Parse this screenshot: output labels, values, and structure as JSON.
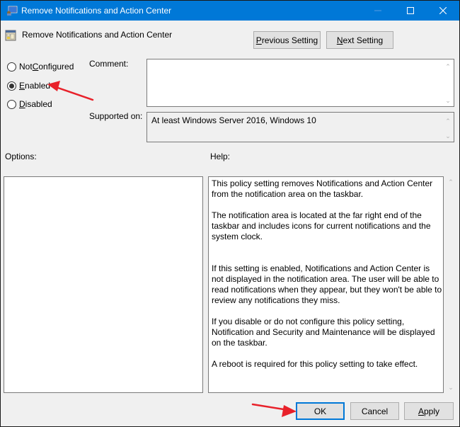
{
  "window": {
    "title": "Remove Notifications and Action Center",
    "controls": {
      "minimize": "minimize",
      "maximize": "maximize",
      "close": "close"
    }
  },
  "header": {
    "policy_name": "Remove Notifications and Action Center",
    "previous_setting": {
      "prefix": "",
      "accel": "P",
      "rest": "revious Setting"
    },
    "next_setting": {
      "prefix": "",
      "accel": "N",
      "rest": "ext Setting"
    }
  },
  "state": {
    "options": [
      {
        "prefix": "Not ",
        "accel": "C",
        "rest": "onfigured",
        "checked": false
      },
      {
        "prefix": "",
        "accel": "E",
        "rest": "nabled",
        "checked": true
      },
      {
        "prefix": "",
        "accel": "D",
        "rest": "isabled",
        "checked": false
      }
    ],
    "selected": "Enabled"
  },
  "labels": {
    "comment": "Comment:",
    "supported_on": "Supported on:",
    "options": "Options:",
    "help": "Help:"
  },
  "fields": {
    "comment_value": "",
    "supported_on_value": "At least Windows Server 2016, Windows 10"
  },
  "help": {
    "paragraphs": [
      "This policy setting removes Notifications and Action Center from the notification area on the taskbar.",
      "The notification area is located at the far right end of the taskbar and includes icons for current notifications and the system clock.",
      "If this setting is enabled, Notifications and Action Center is not displayed in the notification area. The user will be able to read notifications when they appear, but they won't be able to review any notifications they miss.",
      "If you disable or do not configure this policy setting, Notification and Security and Maintenance will be displayed on the taskbar.",
      "A reboot is required for this policy setting to take effect."
    ]
  },
  "footer": {
    "ok": "OK",
    "cancel": "Cancel",
    "apply": {
      "accel": "A",
      "rest": "pply"
    }
  },
  "annotations": {
    "arrow_color": "#e8212a",
    "targets": [
      "enabled-radio",
      "ok-button"
    ]
  },
  "colors": {
    "titlebar": "#0078d7",
    "dialog_bg": "#f0f0f0",
    "button_bg": "#e1e1e1"
  }
}
